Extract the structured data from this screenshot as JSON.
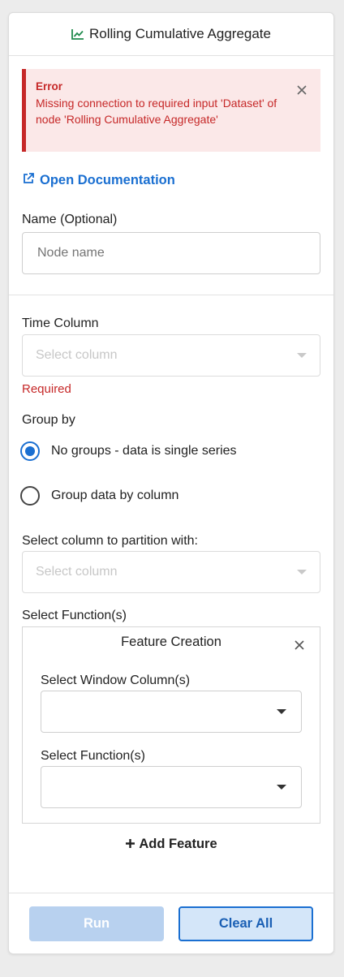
{
  "header": {
    "title": "Rolling Cumulative Aggregate",
    "icon": "line-chart-icon",
    "accent": "#1f8a4c"
  },
  "error": {
    "title": "Error",
    "message": "Missing connection to required input 'Dataset' of node 'Rolling Cumulative Aggregate'",
    "color": "#c62828",
    "background": "#fbe8e8"
  },
  "doc_link": {
    "label": "Open Documentation",
    "icon": "external-link-icon",
    "color": "#1a6fd1"
  },
  "name_field": {
    "label": "Name (Optional)",
    "placeholder": "Node name",
    "value": ""
  },
  "time_column": {
    "label": "Time Column",
    "placeholder": "Select column",
    "validation": "Required"
  },
  "group_by": {
    "label": "Group by",
    "options": [
      {
        "label": "No groups - data is single series",
        "selected": true
      },
      {
        "label": "Group data by column",
        "selected": false
      }
    ]
  },
  "partition": {
    "label": "Select column to partition with:",
    "placeholder": "Select column"
  },
  "functions": {
    "label": "Select Function(s)",
    "feature": {
      "title": "Feature Creation",
      "window_label": "Select Window Column(s)",
      "function_label": "Select Function(s)"
    },
    "add_label": "Add Feature"
  },
  "actions": {
    "run_label": "Run",
    "clear_label": "Clear All"
  }
}
